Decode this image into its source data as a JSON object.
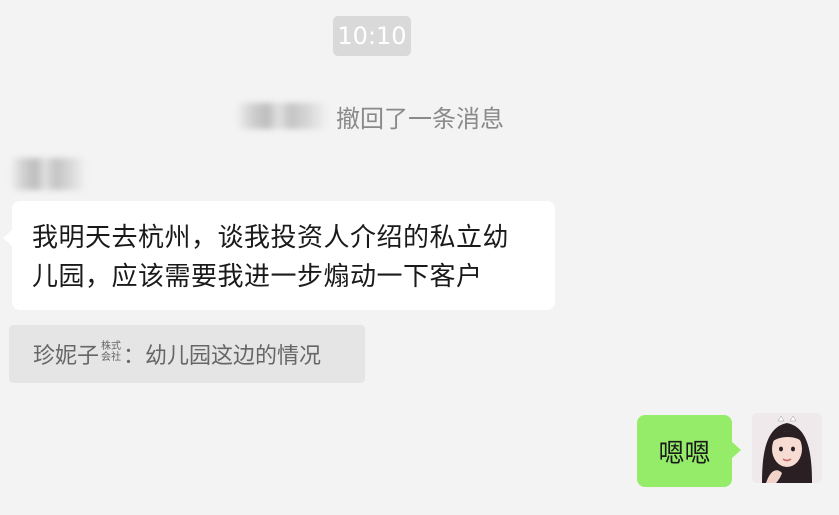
{
  "timestamp": "10:10",
  "recall_notice": {
    "text": "撤回了一条消息"
  },
  "incoming_message": {
    "lines": [
      "我明天去杭州，谈我投资人介绍的私立幼",
      "儿园，应该需要我进一步煽动一下客户"
    ]
  },
  "quote": {
    "name": "珍妮子",
    "company_top": "株式",
    "company_bottom": "会社",
    "separator": "：",
    "text": "幼儿园这边的情况"
  },
  "outgoing_message": {
    "text": "嗯嗯"
  },
  "colors": {
    "background": "#f3f3f3",
    "incoming_bubble": "#ffffff",
    "outgoing_bubble": "#95ec69",
    "time_pill": "#d9d9d9",
    "quote_box": "#e5e5e5"
  }
}
